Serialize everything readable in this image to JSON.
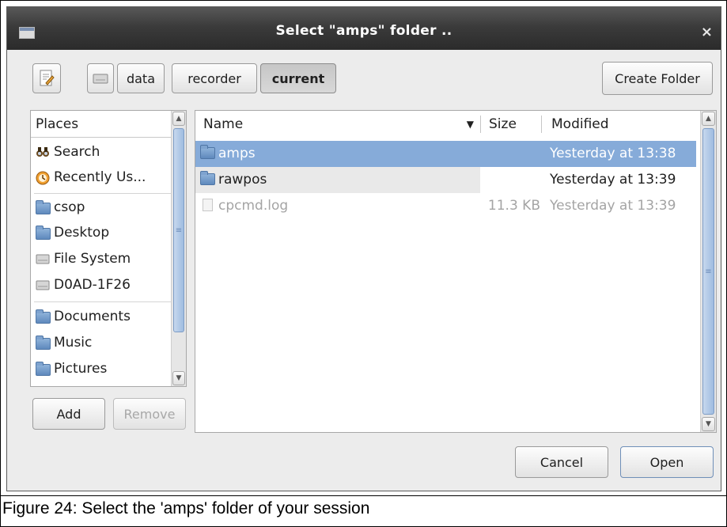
{
  "dialog": {
    "title": "Select \"amps\" folder ..",
    "close_glyph": "×",
    "window_icon": "window-icon"
  },
  "path_bar": {
    "toggle_icon": "edit-location-icon",
    "drive_icon": "drive-icon",
    "segments": [
      "data",
      "recorder",
      "current"
    ],
    "active_segment": "current",
    "create_folder_label": "Create Folder"
  },
  "places": {
    "header": "Places",
    "items": [
      {
        "label": "Search",
        "icon": "binoculars-icon"
      },
      {
        "label": "Recently Us...",
        "icon": "recent-clock-icon"
      },
      {
        "label": "csop",
        "icon": "home-folder-icon"
      },
      {
        "label": "Desktop",
        "icon": "desktop-folder-icon"
      },
      {
        "label": "File System",
        "icon": "drive-icon"
      },
      {
        "label": "D0AD-1F26",
        "icon": "drive-icon"
      },
      {
        "label": "Documents",
        "icon": "documents-folder-icon"
      },
      {
        "label": "Music",
        "icon": "music-folder-icon"
      },
      {
        "label": "Pictures",
        "icon": "pictures-folder-icon"
      }
    ],
    "add_label": "Add",
    "remove_label": "Remove"
  },
  "files": {
    "columns": {
      "name": "Name",
      "size": "Size",
      "modified": "Modified"
    },
    "rows": [
      {
        "name": "amps",
        "type": "folder",
        "size": "",
        "modified": "Yesterday at 13:38",
        "selected": true
      },
      {
        "name": "rawpos",
        "type": "folder",
        "size": "",
        "modified": "Yesterday at 13:39",
        "selected": false
      },
      {
        "name": "cpcmd.log",
        "type": "file",
        "size": "11.3 KB",
        "modified": "Yesterday at 13:39",
        "selected": false
      }
    ]
  },
  "actions": {
    "cancel_label": "Cancel",
    "open_label": "Open"
  },
  "caption": "Figure 24:  Select the 'amps' folder of your session",
  "colors": {
    "selection": "#86abd9",
    "titlebar": "#3b3b3b",
    "dialog_bg": "#ececec"
  }
}
